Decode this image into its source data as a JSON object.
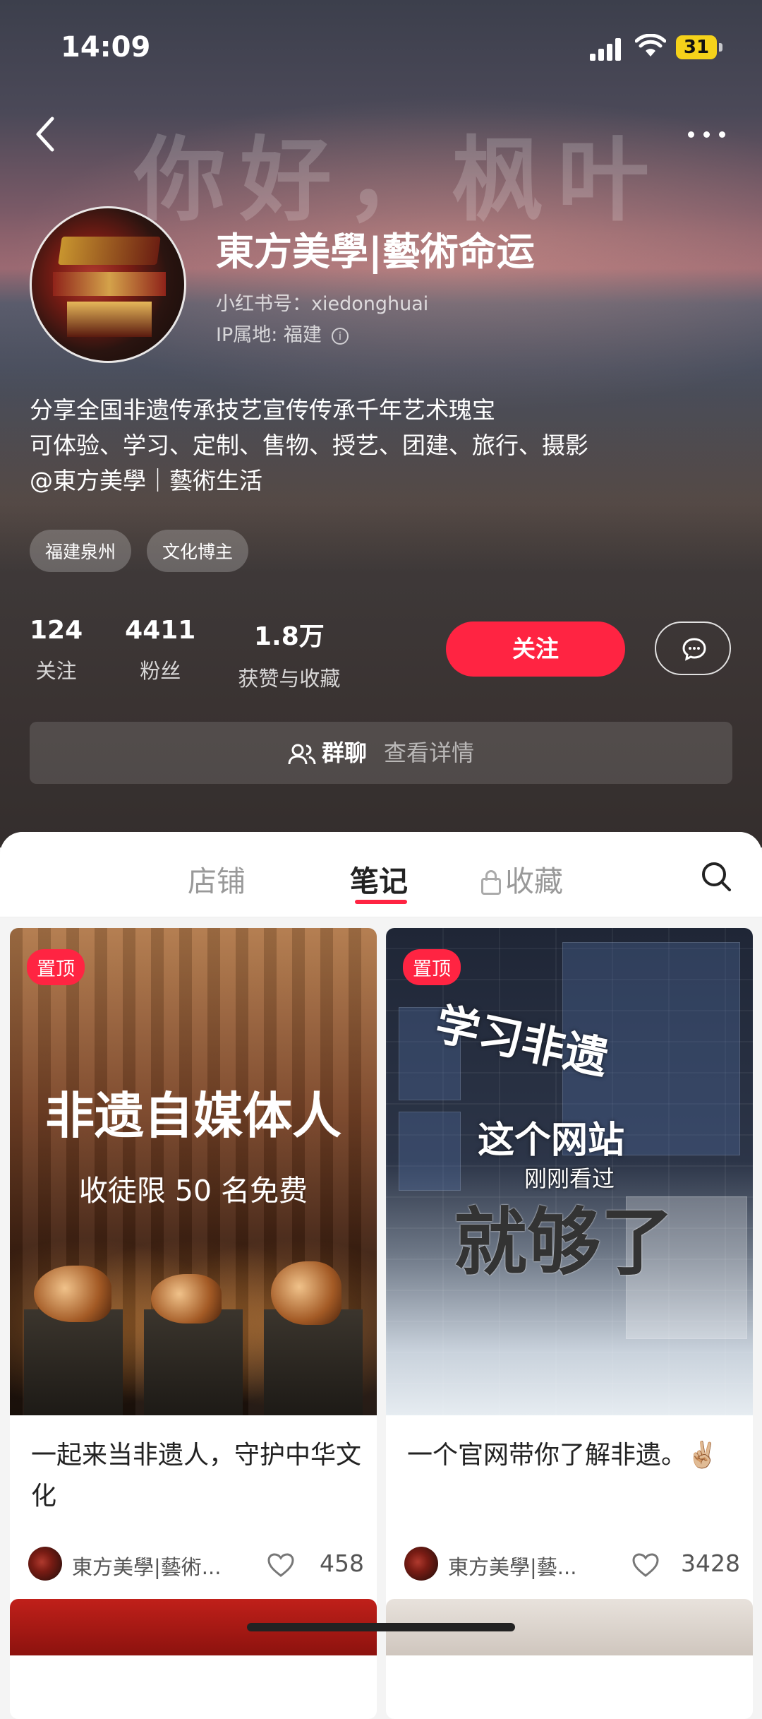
{
  "status_bar": {
    "time": "14:09",
    "battery": "31"
  },
  "header": {
    "watermark": "你好，枫叶"
  },
  "profile": {
    "name": "東方美學|藝術命运",
    "red_id": "小红书号：xiedonghuai",
    "ip": "IP属地: 福建",
    "bio": [
      "分享全国非遗传承技艺宣传传承千年艺术瑰宝",
      "可体验、学习、定制、售物、授艺、团建、旅行、摄影",
      "@東方美學｜藝術生活"
    ],
    "tags": [
      "福建泉州",
      "文化博主"
    ],
    "stats": [
      {
        "num": "124",
        "label": "关注"
      },
      {
        "num": "4411",
        "label": "粉丝"
      },
      {
        "num": "1.8万",
        "label": "获赞与收藏"
      }
    ],
    "follow_label": "关注",
    "group_chat": {
      "title": "群聊",
      "sub": "查看详情"
    }
  },
  "tabs": [
    {
      "label": "店铺"
    },
    {
      "label": "笔记"
    },
    {
      "label": "收藏"
    }
  ],
  "notes": [
    {
      "pin": "置顶",
      "cover_big": "非遗自媒体人",
      "cover_small": "收徒限 50 名免费",
      "title": "一起来当非遗人，守护中华文化",
      "author": "東方美學|藝術...",
      "likes": "458"
    },
    {
      "pin": "置顶",
      "cover_line1": "学习非遗",
      "cover_line2": "这个网站",
      "cover_seen": "刚刚看过",
      "cover_line3": "就够了",
      "title": "一个官网带你了解非遗。✌🏼",
      "author": "東方美學|藝...",
      "likes": "3428"
    }
  ],
  "colors": {
    "accent": "#ff2442"
  }
}
